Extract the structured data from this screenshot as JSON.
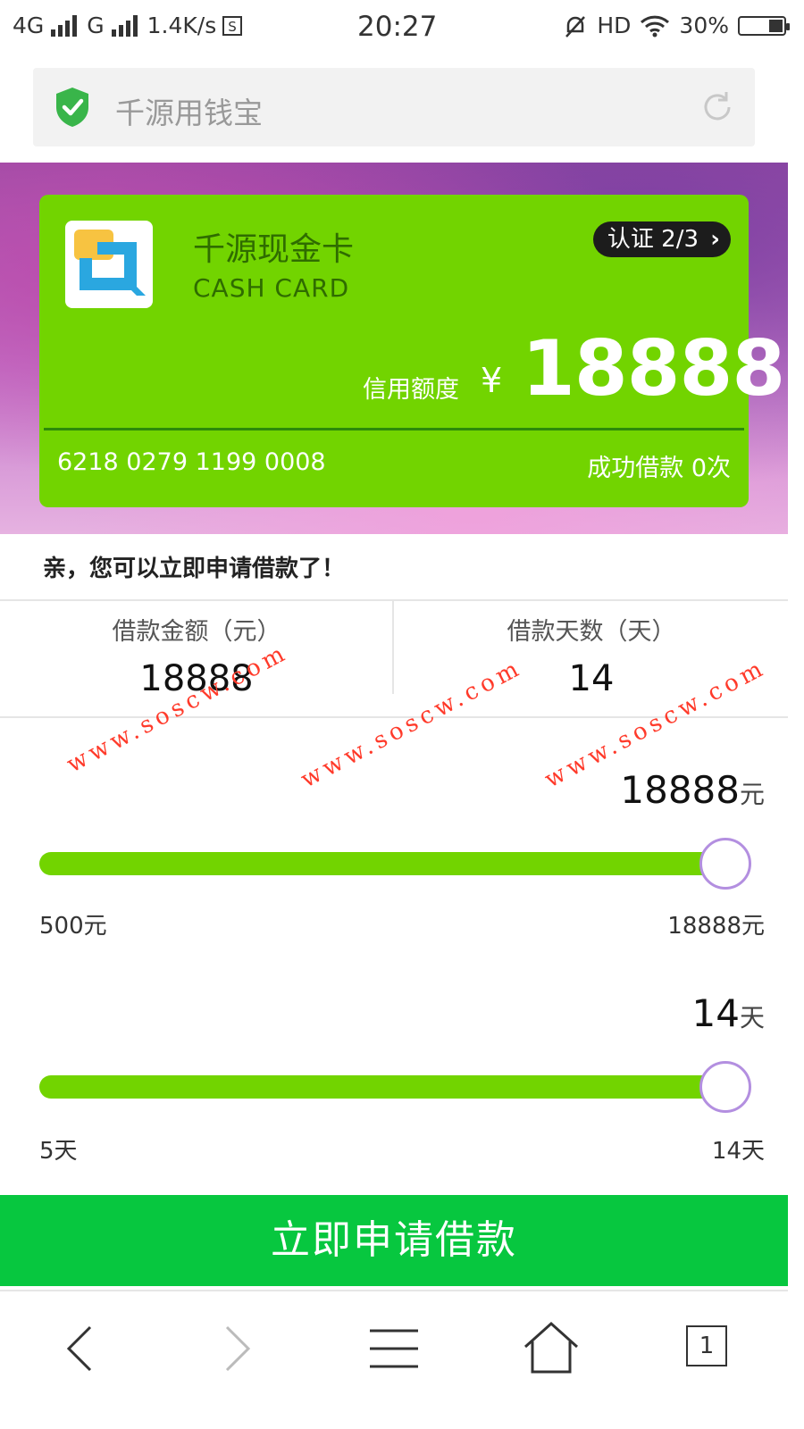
{
  "status_bar": {
    "network1": "4G",
    "network2": "G",
    "speed": "1.4K/s",
    "time": "20:27",
    "hd": "HD",
    "battery": "30%"
  },
  "address_bar": {
    "title": "千源用钱宝"
  },
  "card": {
    "name": "千源现金卡",
    "subtitle": "CASH CARD",
    "verify_label": "认证 2/3",
    "credit_label": "信用额度",
    "currency": "¥",
    "credit_amount": "18888",
    "card_number": "6218 0279 1199 0008",
    "success_loans": "成功借款 0次"
  },
  "prompt": "亲，您可以立即申请借款了！",
  "summary": {
    "amount_label": "借款金额（元）",
    "amount_value": "18888",
    "days_label": "借款天数（天）",
    "days_value": "14"
  },
  "watermark": "www.soscw.com",
  "amount_slider": {
    "value": "18888",
    "unit": "元",
    "min_label": "500元",
    "max_label": "18888元",
    "fraction": 1.0
  },
  "days_slider": {
    "value": "14",
    "unit": "天",
    "min_label": "5天",
    "max_label": "14天",
    "fraction": 1.0
  },
  "apply_button": "立即申请借款",
  "nav": {
    "tab_count": "1"
  },
  "colors": {
    "card_green": "#72d400",
    "button_green": "#07c73f",
    "knob_border": "#b38fe0",
    "watermark_red": "#ff3a2a"
  }
}
